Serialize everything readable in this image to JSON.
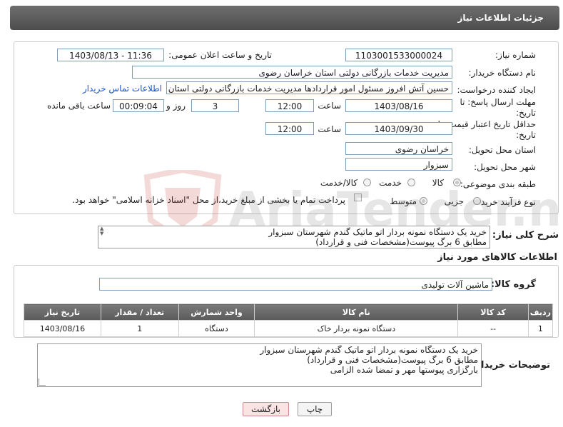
{
  "header": {
    "title": "جزئیات اطلاعات نیاز"
  },
  "form": {
    "need_number_label": "شماره نیاز:",
    "need_number": "1103001533000024",
    "announce_label": "تاریخ و ساعت اعلان عمومی:",
    "announce_value": "1403/08/13 - 11:36",
    "buyer_label": "نام دستگاه خریدار:",
    "buyer_value": "مدیریت خدمات بازرگانی دولتی استان خراسان رضوی",
    "requester_label": "ایجاد کننده درخواست:",
    "requester_value": "حسین آتش افروز مسئول امور قراردادها مدیریت خدمات بازرگانی دولتی استان خ",
    "contact_link": "اطلاعات تماس خریدار",
    "deadline_label_1": "مهلت ارسال پاسخ: تا",
    "deadline_label_2": "تاریخ:",
    "deadline_date": "1403/08/16",
    "time_label": "ساعت",
    "deadline_time": "12:00",
    "days_value": "3",
    "days_label": "روز و",
    "remaining_value": "00:09:04",
    "remaining_label": "ساعت باقی مانده",
    "validity_label_1": "حداقل تاریخ اعتبار قیمت: تا",
    "validity_label_2": "تاریخ:",
    "validity_date": "1403/09/30",
    "validity_time": "12:00",
    "province_label": "استان محل تحویل:",
    "province_value": "خراسان رضوی",
    "city_label": "شهر محل تحویل:",
    "city_value": "سبزوار",
    "category_label": "طبقه بندی موضوعی:",
    "category_options": [
      "کالا",
      "خدمت",
      "کالا/خدمت"
    ],
    "process_label": "نوع فرآیند خرید :",
    "process_options": [
      "جزیی",
      "متوسط"
    ],
    "payment_note": "پرداخت تمام یا بخشی از مبلغ خرید،از محل \"اسناد خزانه اسلامی\" خواهد بود."
  },
  "description": {
    "label": "شرح کلی نیاز:",
    "lines": [
      "خرید یک دستگاه نمونه بردار اتو ماتیک گندم شهرستان سبزوار",
      "مطابق 6 برگ پیوست(مشخصات فنی و قرارداد)"
    ]
  },
  "goods": {
    "section_title": "اطلاعات کالاهای مورد نیاز",
    "group_label": "گروه کالا:",
    "group_value": "ماشین آلات تولیدی",
    "columns": [
      "ردیف",
      "کد کالا",
      "نام کالا",
      "واحد شمارش",
      "تعداد / مقدار",
      "تاریخ نیاز"
    ],
    "rows": [
      {
        "row": "1",
        "code": "--",
        "name": "دستگاه نمونه بردار خاک",
        "unit": "دستگاه",
        "qty": "1",
        "date": "1403/08/16"
      }
    ]
  },
  "buyer_notes": {
    "label": "توضیحات خریدار:",
    "lines": [
      "خرید یک دستگاه نمونه بردار اتو ماتیک گندم شهرستان سبزوار",
      "مطابق 6 برگ پیوست(مشخصات فنی و قرارداد)",
      "بارگزاری پیوستها مهر و تمضا شده الزامی"
    ]
  },
  "buttons": {
    "print": "چاپ",
    "back": "بازگشت"
  },
  "watermark": {
    "text": "AriaTender.neT"
  },
  "colors": {
    "title_bg": "#5e5e5e",
    "link": "#1a56c9",
    "back_button_bg": "#fbe3e3",
    "input_border": "#7f9db9"
  }
}
